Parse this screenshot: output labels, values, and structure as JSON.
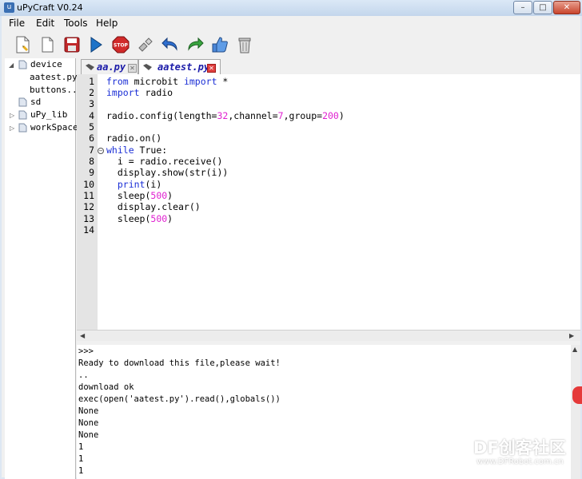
{
  "window": {
    "title": "uPyCraft V0.24",
    "min_label": "–",
    "max_label": "□",
    "close_label": "✕"
  },
  "menu": [
    "File",
    "Edit",
    "Tools",
    "Help"
  ],
  "toolbar": [
    "new-file-icon",
    "open-file-icon",
    "save-icon",
    "run-icon",
    "stop-icon",
    "connect-icon",
    "undo-icon",
    "redo-icon",
    "syntax-check-icon",
    "clear-icon"
  ],
  "tree": {
    "items": [
      {
        "label": "device",
        "expanded": true
      },
      {
        "label": "aatest.py"
      },
      {
        "label": "buttons..."
      },
      {
        "label": "sd"
      },
      {
        "label": "uPy_lib",
        "expanded": false
      },
      {
        "label": "workSpace",
        "expanded": false
      }
    ]
  },
  "tabs": [
    {
      "label": "aa.py",
      "active": false
    },
    {
      "label": "aatest.py",
      "active": true
    }
  ],
  "editor": {
    "line_numbers": [
      "1",
      "2",
      "3",
      "4",
      "5",
      "6",
      "7",
      "8",
      "9",
      "10",
      "11",
      "12",
      "13",
      "14"
    ],
    "lines": [
      [
        {
          "t": "from",
          "c": "kw"
        },
        {
          "t": " microbit "
        },
        {
          "t": "import",
          "c": "kw"
        },
        {
          "t": " *"
        }
      ],
      [
        {
          "t": "import",
          "c": "kw"
        },
        {
          "t": " radio"
        }
      ],
      [],
      [
        {
          "t": "radio.config(length="
        },
        {
          "t": "32",
          "c": "num"
        },
        {
          "t": ",channel="
        },
        {
          "t": "7",
          "c": "num"
        },
        {
          "t": ",group="
        },
        {
          "t": "200",
          "c": "num"
        },
        {
          "t": ")"
        }
      ],
      [],
      [
        {
          "t": "radio.on()"
        }
      ],
      [
        {
          "t": "while",
          "c": "kw"
        },
        {
          "t": " True:"
        }
      ],
      [
        {
          "t": "  i = radio.receive()"
        }
      ],
      [
        {
          "t": "  display.show(str(i))"
        }
      ],
      [
        {
          "t": "  "
        },
        {
          "t": "print",
          "c": "kw"
        },
        {
          "t": "(i)"
        }
      ],
      [
        {
          "t": "  sleep("
        },
        {
          "t": "500",
          "c": "num"
        },
        {
          "t": ")"
        }
      ],
      [
        {
          "t": "  display.clear()"
        }
      ],
      [
        {
          "t": "  sleep("
        },
        {
          "t": "500",
          "c": "num"
        },
        {
          "t": ")"
        }
      ],
      []
    ],
    "fold_marker": "−",
    "colors": {
      "keyword": "#1b2fd6",
      "number": "#e020d0"
    }
  },
  "terminal": {
    "lines": [
      ">>>",
      "Ready to download this file,please wait!",
      "..",
      "download ok",
      "exec(open('aatest.py').read(),globals())",
      "None",
      "None",
      "None",
      "1",
      "1",
      "1"
    ]
  },
  "watermark": {
    "title": "DF创客社区",
    "url": "www.DFRobot.com.cn"
  }
}
